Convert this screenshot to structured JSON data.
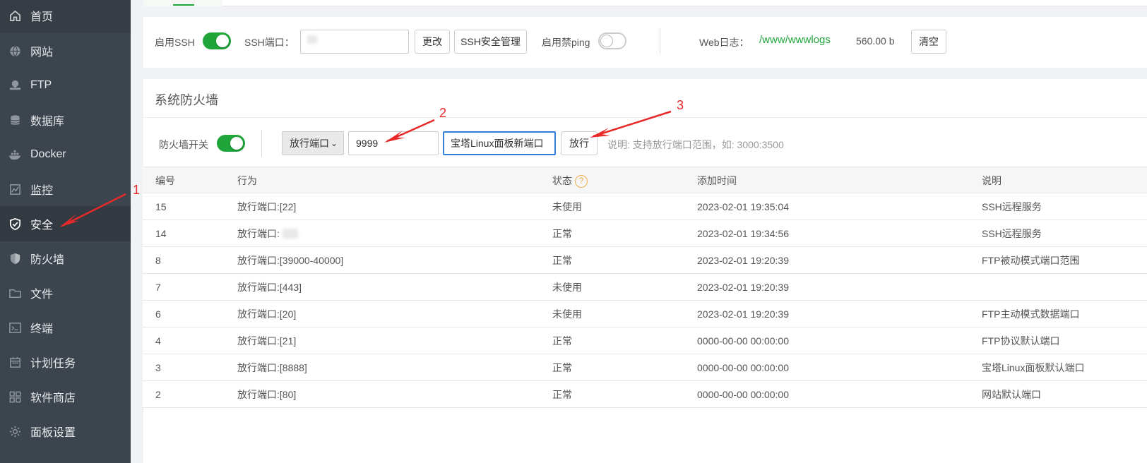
{
  "sidebar": {
    "items": [
      {
        "label": "首页",
        "icon": "home-icon"
      },
      {
        "label": "网站",
        "icon": "globe-icon"
      },
      {
        "label": "FTP",
        "icon": "ftp-icon"
      },
      {
        "label": "数据库",
        "icon": "database-icon"
      },
      {
        "label": "Docker",
        "icon": "docker-icon"
      },
      {
        "label": "监控",
        "icon": "monitor-icon"
      },
      {
        "label": "安全",
        "icon": "shield-check-icon"
      },
      {
        "label": "防火墙",
        "icon": "firewall-icon"
      },
      {
        "label": "文件",
        "icon": "folder-icon"
      },
      {
        "label": "终端",
        "icon": "terminal-icon"
      },
      {
        "label": "计划任务",
        "icon": "calendar-icon"
      },
      {
        "label": "软件商店",
        "icon": "apps-icon"
      },
      {
        "label": "面板设置",
        "icon": "settings-icon"
      }
    ],
    "active_label": "安全"
  },
  "ssh": {
    "enable_label": "启用SSH",
    "enable_state": "on",
    "port_label": "SSH端口：",
    "port_value": "",
    "change_button": "更改",
    "manage_button": "SSH安全管理",
    "ping_label": "启用禁ping",
    "ping_state": "off",
    "weblog_label": "Web日志：",
    "weblog_path": "/www/wwwlogs",
    "weblog_size": "560.00 b",
    "clear_button": "清空"
  },
  "firewall": {
    "title": "系统防火墙",
    "switch_label": "防火墙开关",
    "switch_state": "on",
    "type_select": "放行端口",
    "port_input": "9999",
    "desc_input": "宝塔Linux面板新端口",
    "allow_button": "放行",
    "hint": "说明: 支持放行端口范围，如: 3000:3500",
    "columns": [
      "编号",
      "行为",
      "状态",
      "添加时间",
      "说明"
    ],
    "rows": [
      {
        "id": "15",
        "action": "放行端口:[22]",
        "status": "未使用",
        "time": "2023-02-01 19:35:04",
        "note": "SSH远程服务"
      },
      {
        "id": "14",
        "action": "放行端口:",
        "status": "正常",
        "time": "2023-02-01 19:34:56",
        "note": "SSH远程服务"
      },
      {
        "id": "8",
        "action": "放行端口:[39000-40000]",
        "status": "正常",
        "time": "2023-02-01 19:20:39",
        "note": "FTP被动模式端口范围"
      },
      {
        "id": "7",
        "action": "放行端口:[443]",
        "status": "未使用",
        "time": "2023-02-01 19:20:39",
        "note": ""
      },
      {
        "id": "6",
        "action": "放行端口:[20]",
        "status": "未使用",
        "time": "2023-02-01 19:20:39",
        "note": "FTP主动模式数据端口"
      },
      {
        "id": "4",
        "action": "放行端口:[21]",
        "status": "正常",
        "time": "0000-00-00 00:00:00",
        "note": "FTP协议默认端口"
      },
      {
        "id": "3",
        "action": "放行端口:[8888]",
        "status": "正常",
        "time": "0000-00-00 00:00:00",
        "note": "宝塔Linux面板默认端口"
      },
      {
        "id": "2",
        "action": "放行端口:[80]",
        "status": "正常",
        "time": "0000-00-00 00:00:00",
        "note": "网站默认端口"
      }
    ]
  },
  "annotations": [
    "1",
    "2",
    "3"
  ],
  "colors": {
    "accent": "#20a53a",
    "sidebar_bg": "#3c444d",
    "annotation": "#e8292a",
    "focus": "#2f7fdb"
  }
}
